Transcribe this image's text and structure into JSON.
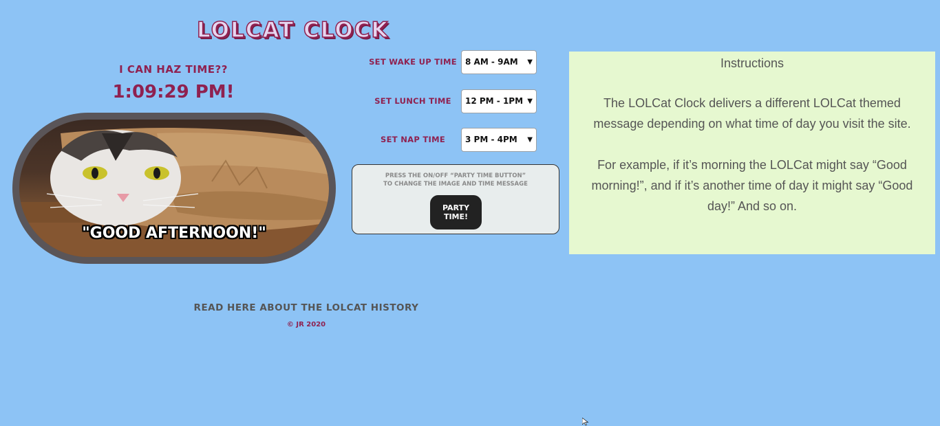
{
  "header": {
    "title": "LOLCAT CLOCK"
  },
  "clock": {
    "heading": "I can haz time??",
    "time": "1:09:29 PM!"
  },
  "cat_image": {
    "caption": "\"GOOD AFTERNOON!\""
  },
  "time_settings": [
    {
      "label": "Set Wake Up Time",
      "selected": "8 AM - 9AM"
    },
    {
      "label": "Set Lunch Time",
      "selected": "12 PM - 1PM"
    },
    {
      "label": "Set Nap Time",
      "selected": "3 PM - 4PM"
    }
  ],
  "party": {
    "instructions_line1": "Press the on/off “party time button”",
    "instructions_line2": "to change the image and time message",
    "button_label": "Party Time!"
  },
  "instructions": {
    "title": "Instructions",
    "paragraph1": "The LOLCat Clock delivers a different LOLCat themed message depending on what time of day you visit the site.",
    "paragraph2": "For example, if it’s morning the LOLCat might say “Good morning!”, and if it’s another time of day it might say “Good day!” And so on."
  },
  "footer": {
    "history_link": "Read here about the LOLcat history",
    "copyright": "© JR 2020"
  },
  "colors": {
    "background": "#8dc3f5",
    "accent": "#8f2150",
    "instructions_bg": "#e6f8d0",
    "panel_bg": "#e8eded",
    "button_bg": "#222222"
  },
  "icons": {
    "dropdown": "chevron-down-icon",
    "cursor": "mouse-pointer-icon"
  }
}
